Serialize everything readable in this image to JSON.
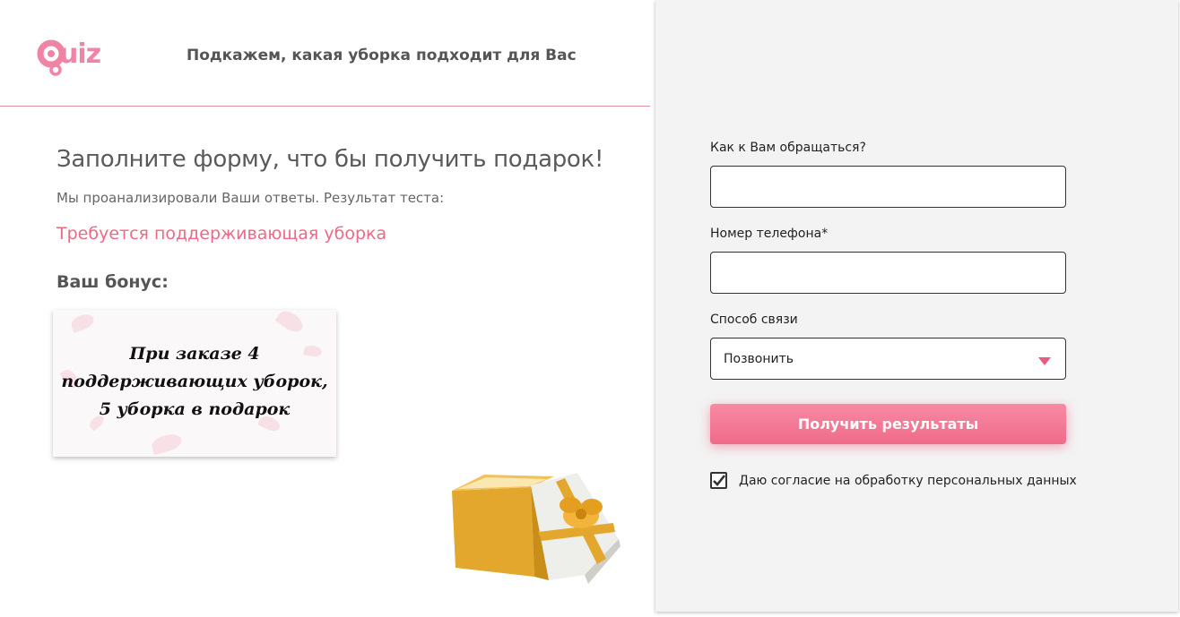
{
  "header": {
    "logo_text": "uiz",
    "title": "Подкажем, какая уборка подходит для Вас"
  },
  "left": {
    "title": "Заполните форму, что бы получить подарок!",
    "subtitle": "Мы проанализировали Ваши ответы. Результат теста:",
    "result": "Требуется поддерживающая уборка",
    "bonus_label": "Ваш бонус:",
    "bonus_card": {
      "line1": "При заказе 4",
      "line2": "поддерживающих уборок,",
      "line3": "5 уборка в подарок"
    }
  },
  "form": {
    "name_label": "Как к Вам обращаться?",
    "name_value": "",
    "phone_label": "Номер телефона*",
    "phone_value": "",
    "contact_label": "Способ связи",
    "contact_selected": "Позвонить",
    "submit_label": "Получить результаты",
    "consent_label": "Даю согласие на обработку персональных данных",
    "consent_checked": true
  },
  "colors": {
    "accent": "#ec6a87",
    "logo": "#ef84a5",
    "panel_bg": "#f3f3f3",
    "gift_gold": "#e2a72c"
  },
  "icons": [
    "quiz-logo-q-icon",
    "dropdown-arrow-icon",
    "checkmark-icon",
    "gift-box-icon"
  ]
}
